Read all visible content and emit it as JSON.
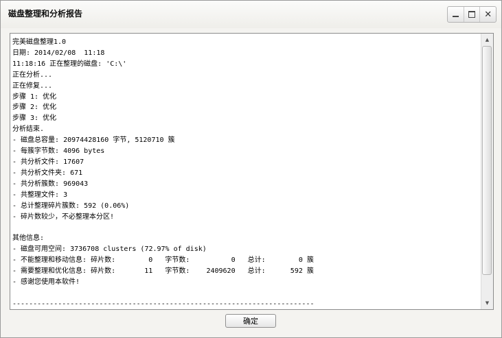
{
  "window": {
    "title": "磁盘整理和分析报告"
  },
  "controls": {
    "minimize_icon": "minimize-icon",
    "maximize_icon": "maximize-icon",
    "close_icon": "close-icon",
    "close_glyph": "✕"
  },
  "report": {
    "lines": [
      "完美磁盘整理1.0",
      "日期: 2014/02/08  11:18",
      "11:18:16 正在整理的磁盘: 'C:\\'",
      "正在分析...",
      "正在修复...",
      "步骤 1: 优化",
      "步骤 2: 优化",
      "步骤 3: 优化",
      "分析结束.",
      "- 磁盘总容量: 20974428160 字节, 5120710 簇",
      "- 每簇字节数: 4096 bytes",
      "- 共分析文件: 17607",
      "- 共分析文件夹: 671",
      "- 共分析簇数: 969043",
      "- 共整理文件: 3",
      "- 总计整理碎片簇数: 592 (0.06%)",
      "- 碎片数较少，不必整理本分区!",
      "",
      "其他信息:",
      "- 磁盘可用空间: 3736708 clusters (72.97% of disk)",
      "- 不能整理和移动信息: 碎片数:        0   字节数:          0   总计:        0 簇",
      "- 需要整理和优化信息: 碎片数:       11   字节数:    2409620   总计:      592 簇",
      "- 感谢您使用本软件!",
      "",
      "-------------------------------------------------------------------------"
    ]
  },
  "scrollbar": {
    "up_glyph": "▲",
    "down_glyph": "▼"
  },
  "footer": {
    "ok_label": "确定"
  }
}
